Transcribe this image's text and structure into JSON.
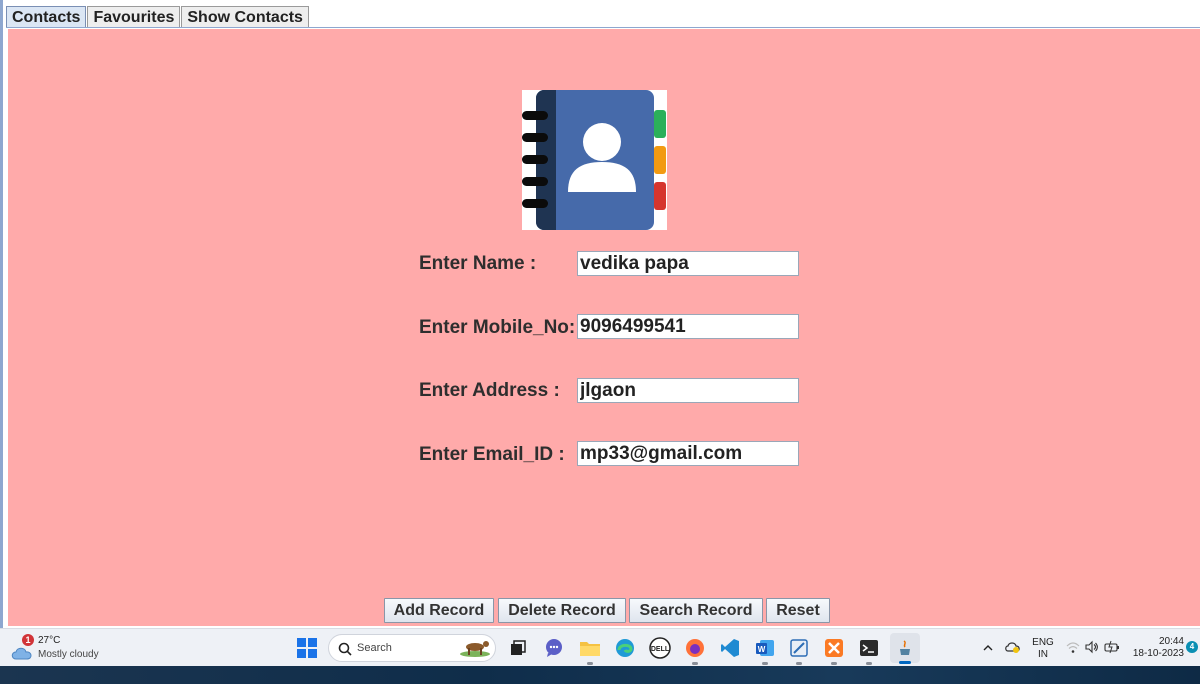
{
  "tabs": [
    {
      "label": "Contacts",
      "active": true
    },
    {
      "label": "Favourites",
      "active": false
    },
    {
      "label": "Show Contacts",
      "active": false
    }
  ],
  "form": {
    "name_label": "Enter Name :",
    "name_value": "vedika papa",
    "mobile_label": "Enter Mobile_No:",
    "mobile_value": "9096499541",
    "address_label": "Enter Address :",
    "address_value": "jlgaon",
    "email_label": "Enter Email_ID :",
    "email_value": "mp33@gmail.com"
  },
  "buttons": {
    "add": "Add Record",
    "delete": "Delete Record",
    "search": "Search Record",
    "reset": "Reset"
  },
  "logo": {
    "icon": "address-book-icon"
  },
  "colors": {
    "panel_bg": "#ffaaaa",
    "tab_active": "#dbe6f4"
  },
  "taskbar": {
    "weather_temp": "27°C",
    "weather_desc": "Mostly cloudy",
    "weather_badge": "1",
    "search_placeholder": "Search",
    "lang_top": "ENG",
    "lang_bottom": "IN",
    "time": "20:44",
    "date": "18-10-2023",
    "notification_count": "4",
    "dell_label": "DELL",
    "word_label": "W"
  }
}
